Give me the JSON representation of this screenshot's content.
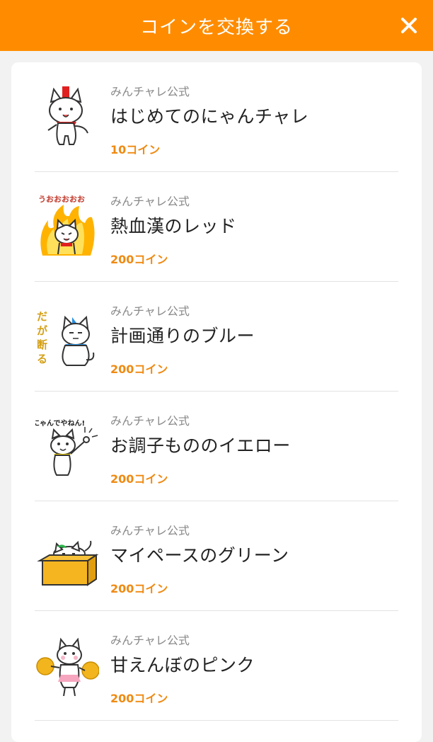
{
  "header": {
    "title": "コインを交換する",
    "close_icon": "close-icon"
  },
  "colors": {
    "accent": "#ff8c00",
    "price": "#ef8a12"
  },
  "items": [
    {
      "publisher": "みんチャレ公式",
      "title": "はじめてのにゃんチャレ",
      "price": "10コイン",
      "sticker_icon": "cat-red-bandana-sticker"
    },
    {
      "publisher": "みんチャレ公式",
      "title": "熱血漢のレッド",
      "price": "200コイン",
      "sticker_icon": "cat-fire-sticker",
      "sticker_text": "うおおおおお"
    },
    {
      "publisher": "みんチャレ公式",
      "title": "計画通りのブルー",
      "price": "200コイン",
      "sticker_icon": "cat-blue-sticker",
      "sticker_text": "だが断る"
    },
    {
      "publisher": "みんチャレ公式",
      "title": "お調子もののイエロー",
      "price": "200コイン",
      "sticker_icon": "cat-yellow-sticker",
      "sticker_text": "にゃんでやねん!"
    },
    {
      "publisher": "みんチャレ公式",
      "title": "マイペースのグリーン",
      "price": "200コイン",
      "sticker_icon": "cat-box-sticker"
    },
    {
      "publisher": "みんチャレ公式",
      "title": "甘えんぼのピンク",
      "price": "200コイン",
      "sticker_icon": "cat-pink-cheer-sticker"
    }
  ]
}
